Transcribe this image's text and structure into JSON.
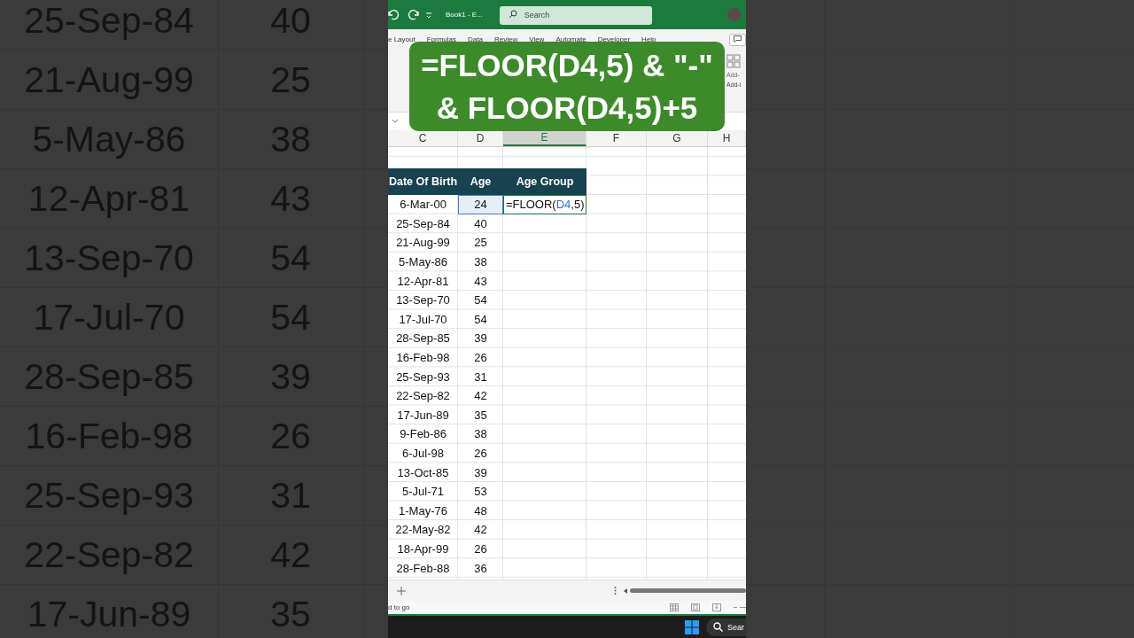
{
  "backdrop": {
    "rows": [
      {
        "date": "25-Sep-84",
        "age": "40"
      },
      {
        "date": "21-Aug-99",
        "age": "25"
      },
      {
        "date": "5-May-86",
        "age": "38"
      },
      {
        "date": "12-Apr-81",
        "age": "43"
      },
      {
        "date": "13-Sep-70",
        "age": "54"
      },
      {
        "date": "17-Jul-70",
        "age": "54"
      },
      {
        "date": "28-Sep-85",
        "age": "39"
      },
      {
        "date": "16-Feb-98",
        "age": "26"
      },
      {
        "date": "25-Sep-93",
        "age": "31"
      },
      {
        "date": "22-Sep-82",
        "age": "42"
      },
      {
        "date": "17-Jun-89",
        "age": "35"
      }
    ]
  },
  "titlebar": {
    "document_title": "Book1  -  E...",
    "search": {
      "placeholder": "Search"
    }
  },
  "ribbon": {
    "tabs": [
      {
        "label": "e Layout",
        "selected": false
      },
      {
        "label": "Formulas",
        "selected": false
      },
      {
        "label": "Data",
        "selected": false
      },
      {
        "label": "Review",
        "selected": false
      },
      {
        "label": "View",
        "selected": false
      },
      {
        "label": "Automate",
        "selected": false
      },
      {
        "label": "Developer",
        "selected": false
      },
      {
        "label": "Help",
        "selected": false
      }
    ],
    "addin_button": "Add-",
    "addin_group": "Add-i"
  },
  "callout": {
    "lines": [
      "=FLOOR(D4,5) & \"-\"",
      "& FLOOR(D4,5)+5"
    ]
  },
  "grid": {
    "columns": [
      {
        "label": "C",
        "selected": false
      },
      {
        "label": "D",
        "selected": false
      },
      {
        "label": "E",
        "selected": true
      },
      {
        "label": "F",
        "selected": false
      },
      {
        "label": "G",
        "selected": false
      },
      {
        "label": "H",
        "selected": false
      }
    ],
    "header": [
      "Date Of Birth",
      "Age",
      "Age Group"
    ],
    "editing": {
      "before": "=FLOOR(",
      "ref": "D4",
      "after": ",5)"
    },
    "rows": [
      {
        "date": "6-Mar-00",
        "age": "24",
        "selected": true
      },
      {
        "date": "25-Sep-84",
        "age": "40",
        "selected": false
      },
      {
        "date": "21-Aug-99",
        "age": "25",
        "selected": false
      },
      {
        "date": "5-May-86",
        "age": "38",
        "selected": false
      },
      {
        "date": "12-Apr-81",
        "age": "43",
        "selected": false
      },
      {
        "date": "13-Sep-70",
        "age": "54",
        "selected": false
      },
      {
        "date": "17-Jul-70",
        "age": "54",
        "selected": false
      },
      {
        "date": "28-Sep-85",
        "age": "39",
        "selected": false
      },
      {
        "date": "16-Feb-98",
        "age": "26",
        "selected": false
      },
      {
        "date": "25-Sep-93",
        "age": "31",
        "selected": false
      },
      {
        "date": "22-Sep-82",
        "age": "42",
        "selected": false
      },
      {
        "date": "17-Jun-89",
        "age": "35",
        "selected": false
      },
      {
        "date": "9-Feb-86",
        "age": "38",
        "selected": false
      },
      {
        "date": "6-Jul-98",
        "age": "26",
        "selected": false
      },
      {
        "date": "13-Oct-85",
        "age": "39",
        "selected": false
      },
      {
        "date": "5-Jul-71",
        "age": "53",
        "selected": false
      },
      {
        "date": "1-May-76",
        "age": "48",
        "selected": false
      },
      {
        "date": "22-May-82",
        "age": "42",
        "selected": false
      },
      {
        "date": "18-Apr-99",
        "age": "26",
        "selected": false
      },
      {
        "date": "28-Feb-88",
        "age": "36",
        "selected": false
      }
    ]
  },
  "status": {
    "text": "d to go"
  },
  "taskbar": {
    "search": "Sear"
  }
}
